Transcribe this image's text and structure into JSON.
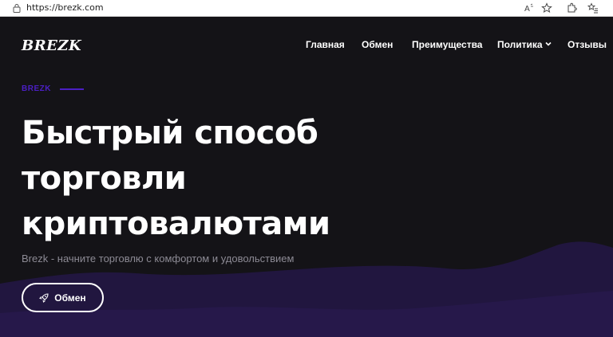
{
  "browser": {
    "url": "https://brezk.com",
    "icons": [
      "lock-icon",
      "read-aloud-icon",
      "favorite-star-icon",
      "extensions-icon",
      "favorites-list-icon"
    ]
  },
  "header": {
    "logo": "BREZK",
    "nav": [
      {
        "label": "Главная"
      },
      {
        "label": "Обмен"
      },
      {
        "label": "Преимущества"
      },
      {
        "label": "Политика",
        "icon": "chevron-down-icon"
      },
      {
        "label": "Отзывы"
      }
    ]
  },
  "hero": {
    "eyebrow": "BREZK",
    "headline_lines": [
      "Быстрый способ",
      "торговли",
      "криптовалютами"
    ],
    "subtitle": "Brezk - начните торговлю с комфортом и удовольствием",
    "cta_label": "Обмен",
    "cta_icon": "rocket-icon"
  },
  "colors": {
    "background": "#141317",
    "accent": "#4b1fc4",
    "wave": "#21163f",
    "text": "#ffffff",
    "muted": "#8c8a94"
  }
}
